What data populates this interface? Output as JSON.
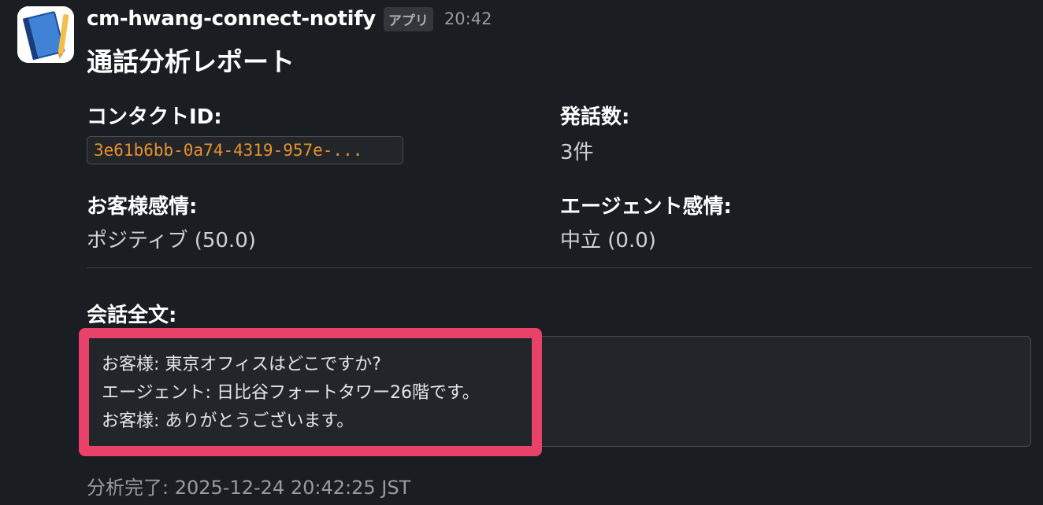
{
  "app": {
    "name": "cm-hwang-connect-notify",
    "badge": "アプリ",
    "time": "20:42",
    "avatar_icon": "notebook-icon"
  },
  "report": {
    "title": "通話分析レポート",
    "contact_id_label": "コンタクトID:",
    "contact_id_value": "3e61b6bb-0a74-4319-957e-...",
    "utterance_count_label": "発話数:",
    "utterance_count_value": "3件",
    "customer_sentiment_label": "お客様感情:",
    "customer_sentiment_value": "ポジティブ (50.0)",
    "agent_sentiment_label": "エージェント感情:",
    "agent_sentiment_value": "中立 (0.0)",
    "transcript_label": "会話全文:",
    "transcript_lines": [
      "お客様: 東京オフィスはどこですか?",
      "エージェント: 日比谷フォートタワー26階です。",
      "お客様: ありがとうございます。"
    ],
    "footer": "分析完了: 2025-12-24 20:42:25 JST"
  },
  "colors": {
    "background": "#1a1d21",
    "code_text": "#e8912d",
    "highlight_border": "#e8416a"
  }
}
